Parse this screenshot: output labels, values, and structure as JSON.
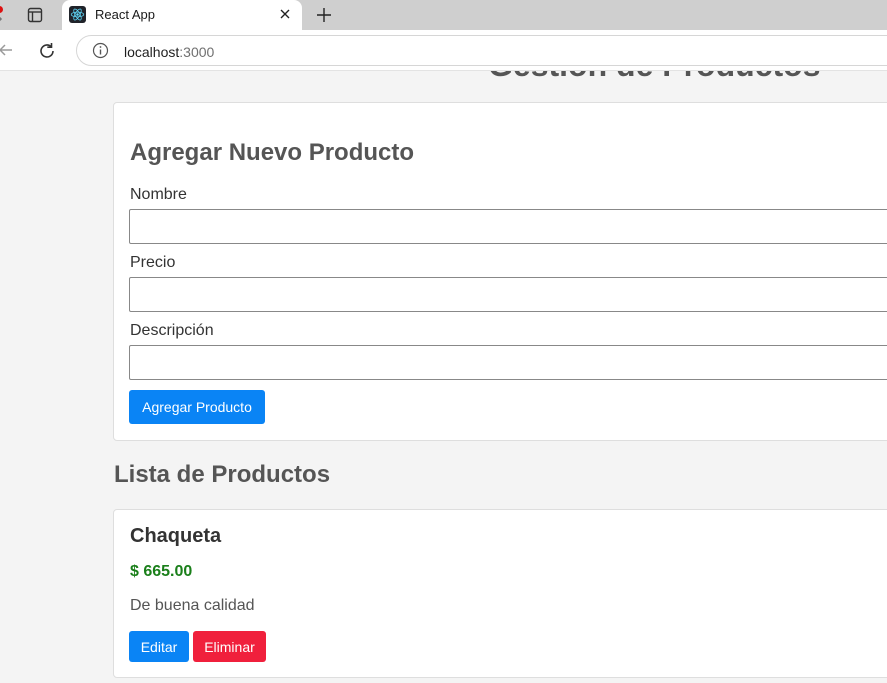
{
  "browser": {
    "tab": {
      "title": "React App",
      "favicon": "react-logo-icon"
    },
    "address": {
      "host": "localhost",
      "port": ":3000"
    }
  },
  "page": {
    "title": "Gestión de Productos",
    "form": {
      "heading": "Agregar Nuevo Producto",
      "fields": [
        {
          "label": "Nombre",
          "value": ""
        },
        {
          "label": "Precio",
          "value": ""
        },
        {
          "label": "Descripción",
          "value": ""
        }
      ],
      "submit_label": "Agregar Producto"
    },
    "list": {
      "heading": "Lista de Productos",
      "products": [
        {
          "name": "Chaqueta",
          "price": "$ 665.00",
          "description": "De buena calidad",
          "edit_label": "Editar",
          "delete_label": "Eliminar"
        }
      ]
    }
  },
  "colors": {
    "primary": "#0a84f5",
    "danger": "#f0203c",
    "price": "#1a7f1a"
  }
}
